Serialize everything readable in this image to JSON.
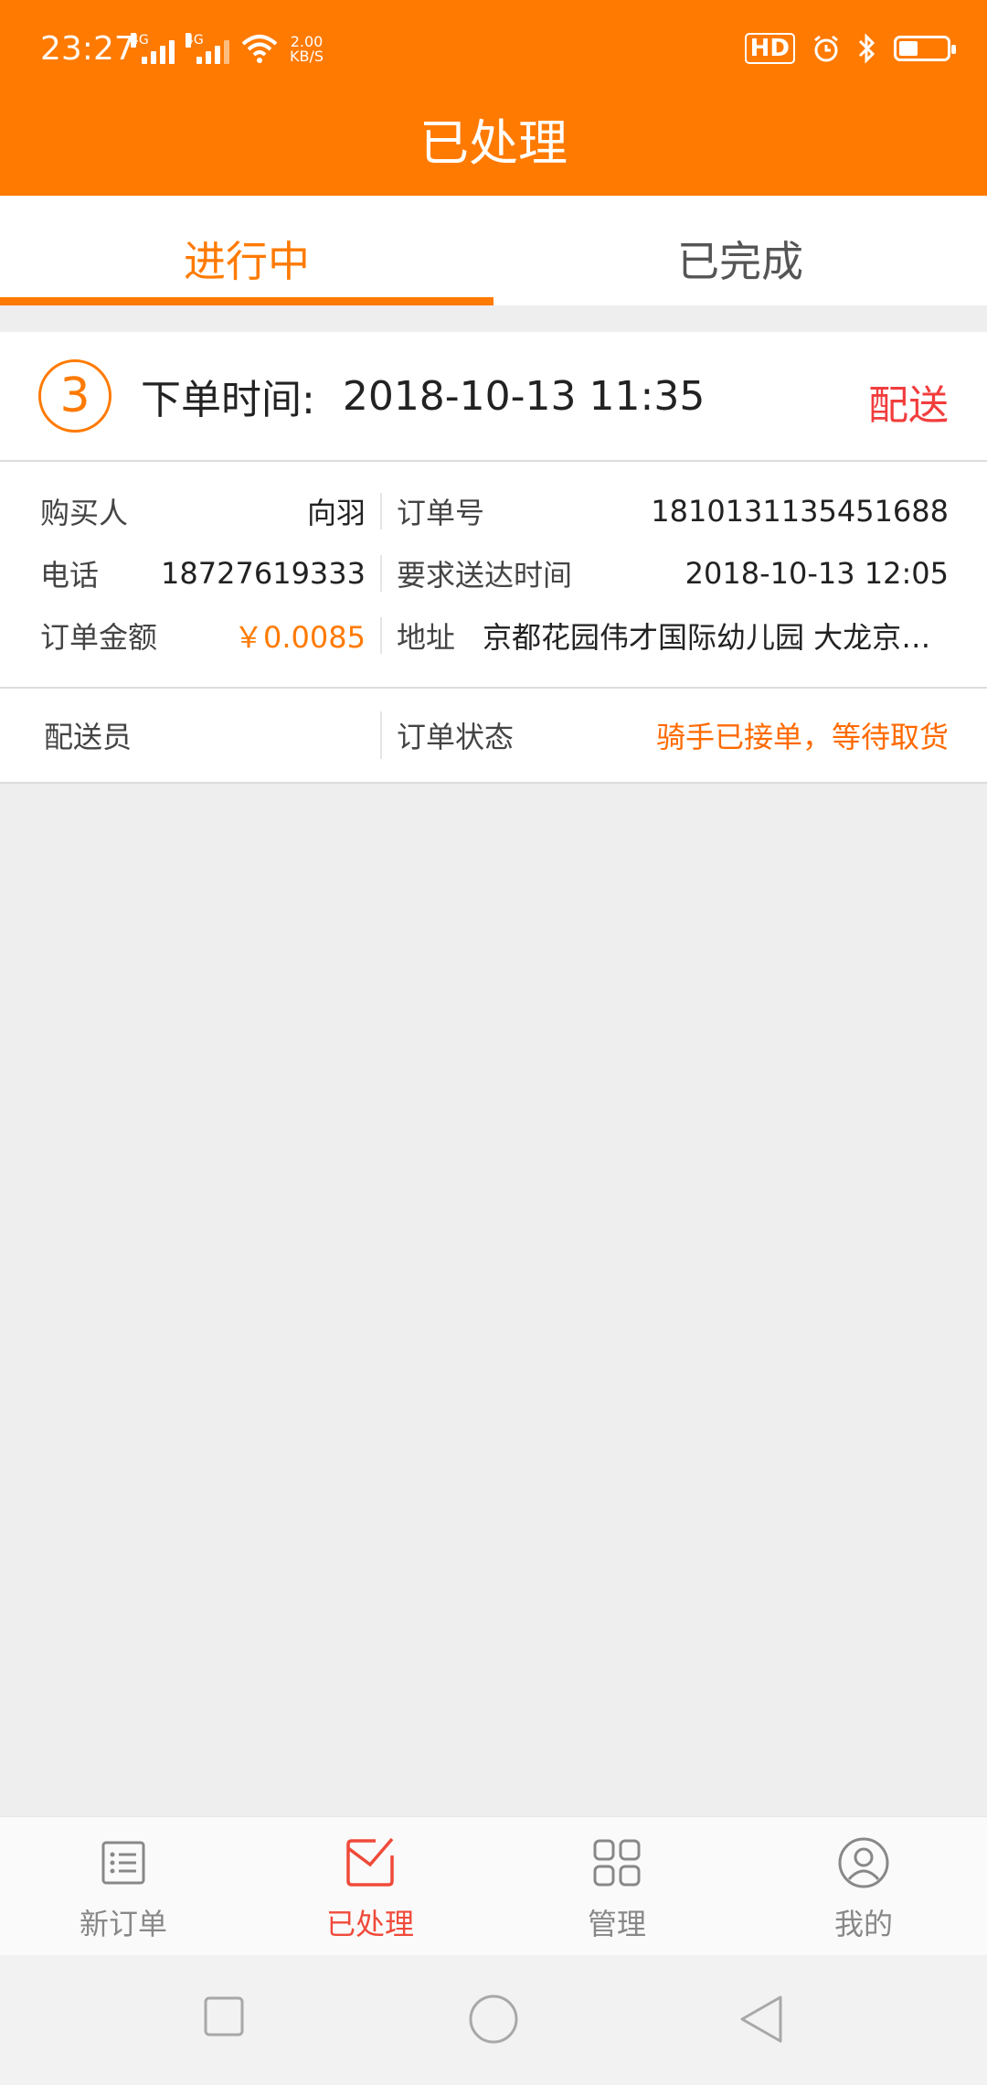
{
  "status_bar": {
    "time": "23:27",
    "signal_1": "4G",
    "signal_2": "4G",
    "net_speed_value": "2.00",
    "net_speed_unit": "KB/S",
    "hd_label": "HD"
  },
  "header": {
    "title": "已处理"
  },
  "tabs": [
    {
      "label": "进行中",
      "active": true
    },
    {
      "label": "已完成",
      "active": false
    }
  ],
  "order": {
    "index": "3",
    "time_label": "下单时间:",
    "time_value": "2018-10-13 11:35",
    "action_label": "配送",
    "buyer_label": "购买人",
    "buyer_value": "向羽",
    "order_no_label": "订单号",
    "order_no_value": "1810131135451688",
    "phone_label": "电话",
    "phone_value": "18727619333",
    "deliver_time_label": "要求送达时间",
    "deliver_time_value": "2018-10-13 12:05",
    "amount_label": "订单金额",
    "amount_value": "￥0.0085",
    "address_label": "地址",
    "address_value": "京都花园伟才国际幼儿园 大龙京都…",
    "courier_label": "配送员",
    "courier_value": "",
    "status_label": "订单状态",
    "status_value": "骑手已接单，等待取货"
  },
  "bottom_nav": [
    {
      "label": "新订单",
      "icon": "list-icon",
      "active": false
    },
    {
      "label": "已处理",
      "icon": "processed-icon",
      "active": true
    },
    {
      "label": "管理",
      "icon": "grid-icon",
      "active": false
    },
    {
      "label": "我的",
      "icon": "profile-icon",
      "active": false
    }
  ],
  "colors": {
    "brand": "#ff7a00",
    "action_red": "#f23d3d",
    "nav_active": "#f04a3a"
  }
}
